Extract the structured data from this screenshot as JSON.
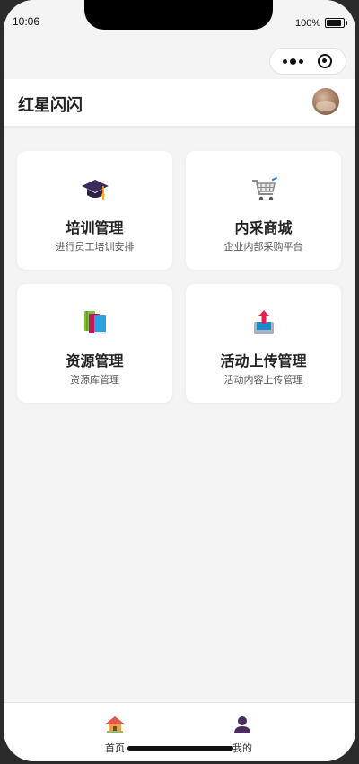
{
  "status_bar": {
    "time": "10:06",
    "battery": "100%"
  },
  "header": {
    "title": "红星闪闪"
  },
  "cards": [
    {
      "title": "培训管理",
      "desc": "进行员工培训安排",
      "icon": "graduation-cap-icon"
    },
    {
      "title": "内采商城",
      "desc": "企业内部采购平台",
      "icon": "shopping-cart-icon"
    },
    {
      "title": "资源管理",
      "desc": "资源库管理",
      "icon": "books-icon"
    },
    {
      "title": "活动上传管理",
      "desc": "活动内容上传管理",
      "icon": "upload-tray-icon"
    }
  ],
  "tabbar": {
    "items": [
      {
        "label": "首页",
        "icon": "home-icon"
      },
      {
        "label": "我的",
        "icon": "user-icon"
      }
    ]
  },
  "colors": {
    "background": "#f4f4f4",
    "card": "#ffffff",
    "text": "#222222"
  }
}
